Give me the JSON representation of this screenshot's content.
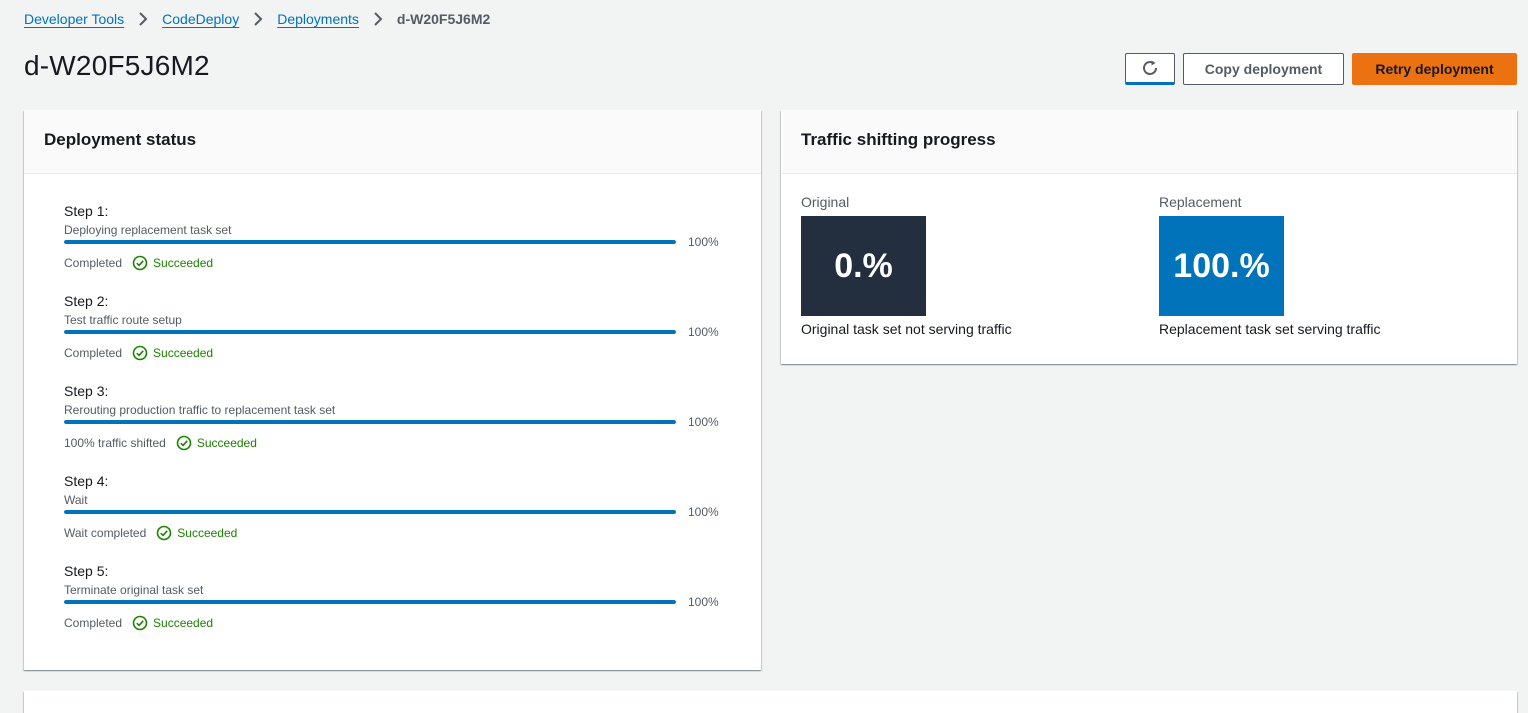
{
  "breadcrumb": {
    "items": [
      "Developer Tools",
      "CodeDeploy",
      "Deployments"
    ],
    "current": "d-W20F5J6M2"
  },
  "page": {
    "title": "d-W20F5J6M2"
  },
  "actions": {
    "refresh_icon": "refresh-icon",
    "copy_label": "Copy deployment",
    "retry_label": "Retry deployment"
  },
  "deployment_status": {
    "title": "Deployment status",
    "steps": [
      {
        "title": "Step 1:",
        "description": "Deploying replacement task set",
        "progress": 100,
        "progress_label": "100%",
        "status_text": "Completed",
        "result": "Succeeded"
      },
      {
        "title": "Step 2:",
        "description": "Test traffic route setup",
        "progress": 100,
        "progress_label": "100%",
        "status_text": "Completed",
        "result": "Succeeded"
      },
      {
        "title": "Step 3:",
        "description": "Rerouting production traffic to replacement task set",
        "progress": 100,
        "progress_label": "100%",
        "status_text": "100% traffic shifted",
        "result": "Succeeded"
      },
      {
        "title": "Step 4:",
        "description": "Wait",
        "progress": 100,
        "progress_label": "100%",
        "status_text": "Wait completed",
        "result": "Succeeded"
      },
      {
        "title": "Step 5:",
        "description": "Terminate original task set",
        "progress": 100,
        "progress_label": "100%",
        "status_text": "Completed",
        "result": "Succeeded"
      }
    ]
  },
  "traffic_shifting": {
    "title": "Traffic shifting progress",
    "original": {
      "label": "Original",
      "value": "0.%",
      "caption": "Original task set not serving traffic",
      "color": "#232f3e"
    },
    "replacement": {
      "label": "Replacement",
      "value": "100.%",
      "caption": "Replacement task set serving traffic",
      "color": "#0073bb"
    }
  },
  "colors": {
    "link": "#0073bb",
    "primary_button": "#ec7211",
    "success": "#1d8102",
    "progress": "#0073bb"
  }
}
